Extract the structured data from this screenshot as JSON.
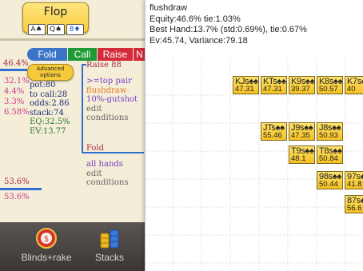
{
  "street": {
    "title": "Flop",
    "cards": [
      {
        "rank": "A",
        "suit": "♠",
        "suit_icon": "spade-icon",
        "color": "#222222"
      },
      {
        "rank": "Q",
        "suit": "♠",
        "suit_icon": "spade-icon",
        "color": "#222222"
      },
      {
        "rank": "8",
        "suit": "♦",
        "suit_icon": "diamond-icon",
        "color": "#1a56c8"
      }
    ]
  },
  "actions": {
    "fold": "Fold",
    "call": "Call",
    "raise": "Raise",
    "more": "N"
  },
  "left_stats": {
    "top_pct": "46.4%",
    "pcts": [
      "32.1%",
      "4.4%",
      "3.3%",
      "6.58%"
    ],
    "advanced_label": "Advanced options",
    "pot": "pot:80",
    "to_call": "to call:28",
    "odds": "odds:2.86",
    "stack": "stack:74",
    "eq": "EQ:32.5%",
    "ev": "EV:13.77",
    "bottom_pct_1": "53.6%",
    "bottom_pct_2": "53.6%"
  },
  "tree": {
    "raise_node": "Raise 88",
    "cond_1": ">=top pair",
    "cond_2": "flushdraw",
    "cond_3": "10%-gutshot",
    "edit_1": "edit conditions",
    "fold_node": "Fold",
    "all_hands": "all hands",
    "edit_2": "edit conditions"
  },
  "bottom_tabs": [
    {
      "label": "Blinds+rake",
      "icon": "poker-chip-icon"
    },
    {
      "label": "Stacks",
      "icon": "chip-stacks-icon"
    }
  ],
  "popup": {
    "name": "flushdraw",
    "line1": "Equity:46.6% tie:1.03%",
    "line2": "Best Hand:13.7% (std:0.69%), tie:0.67%",
    "line3": "Ev:45.74, Variance:79.18"
  },
  "hands": [
    {
      "name": "KJs",
      "value": "47.31"
    },
    {
      "name": "KTs",
      "value": "47.31"
    },
    {
      "name": "K9s",
      "value": "39.37"
    },
    {
      "name": "K8s",
      "value": "50.57"
    },
    {
      "name": "K7s",
      "value": "40"
    },
    {
      "name": "JTs",
      "value": "55.46"
    },
    {
      "name": "J9s",
      "value": "47.35"
    },
    {
      "name": "J8s",
      "value": "50.93"
    },
    {
      "name": "T9s",
      "value": "48.1"
    },
    {
      "name": "T8s",
      "value": "50.84"
    },
    {
      "name": "98s",
      "value": "50.44"
    },
    {
      "name": "97s",
      "value": "41.8"
    },
    {
      "name": "87s",
      "value": "56.6"
    }
  ],
  "suit_marker": "♠♠",
  "colors": {
    "background": "#f4eed8",
    "fold": "#3b73c6",
    "call": "#1f9b35",
    "raise": "#d42b3b",
    "hand_cell": "#f5c021",
    "bar": "#2f6fd0"
  }
}
